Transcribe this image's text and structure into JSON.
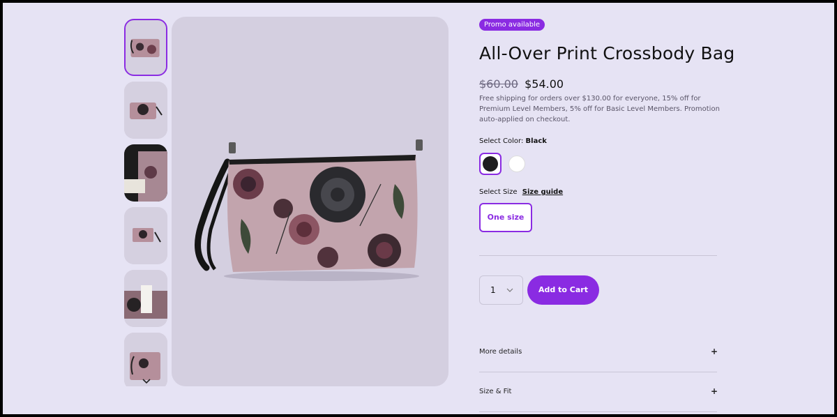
{
  "gallery": {
    "thumbnails": [
      {
        "label": "bag-front-with-strap",
        "selected": true
      },
      {
        "label": "bag-front-small",
        "selected": false
      },
      {
        "label": "bag-interior",
        "selected": false
      },
      {
        "label": "bag-front-zoomed-out",
        "selected": false
      },
      {
        "label": "bag-with-tag",
        "selected": false
      },
      {
        "label": "bag-partial",
        "selected": false
      }
    ],
    "scroll_icon": "chevron-down-icon"
  },
  "product": {
    "promo_badge": "Promo available",
    "title": "All-Over Print Crossbody Bag",
    "price_old": "$60.00",
    "price_new": "$54.00",
    "shipping_note": "Free shipping for orders over $130.00 for everyone, 15% off for Premium Level Members, 5% off for Basic Level Members. Promotion auto-applied on checkout."
  },
  "color": {
    "label": "Select Color:",
    "selected": "Black",
    "options": [
      {
        "name": "Black",
        "hex": "#1e1e1e",
        "selected": true
      },
      {
        "name": "White",
        "hex": "#ffffff",
        "selected": false
      }
    ]
  },
  "size": {
    "label": "Select Size",
    "guide_link": "Size guide",
    "options": [
      "One size"
    ]
  },
  "cart": {
    "quantity": "1",
    "add_button": "Add to Cart"
  },
  "accordions": [
    {
      "label": "More details",
      "icon": "+"
    },
    {
      "label": "Size & Fit",
      "icon": "+"
    }
  ],
  "colors": {
    "accent": "#8a2be2",
    "page_bg": "#e6e3f4",
    "image_bg": "#d4cfe0"
  }
}
